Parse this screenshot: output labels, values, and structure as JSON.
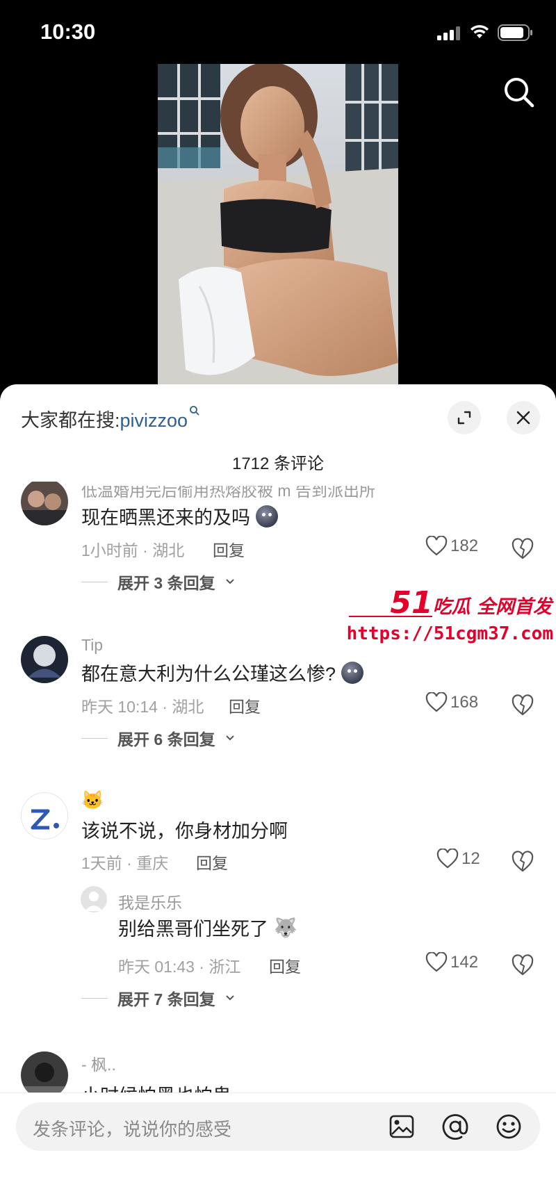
{
  "status_bar": {
    "time": "10:30"
  },
  "sheet": {
    "search_prefix": "大家都在搜:",
    "search_keyword": "pivizzoo",
    "comment_count": "1712 条评论"
  },
  "comments": [
    {
      "username": "低温婚用完后偷用热熔胶被 m 告到派出所",
      "text": "现在晒黑还来的及吗",
      "time_location": "1小时前 · 湖北",
      "reply": "回复",
      "likes": "182",
      "expand": "展开 3 条回复"
    },
    {
      "username": "Tip",
      "text": "都在意大利为什么公瑾这么惨?",
      "time_location": "昨天 10:14 · 湖北",
      "reply": "回复",
      "likes": "168",
      "expand": "展开 6 条回复"
    },
    {
      "username": "🐱",
      "text": "该说不说，你身材加分啊",
      "time_location": "1天前 · 重庆",
      "reply": "回复",
      "likes": "12",
      "sub_reply": {
        "username": "我是乐乐",
        "text": "别给黑哥们坐死了",
        "time_location": "昨天 01:43 · 浙江",
        "reply": "回复",
        "likes": "142"
      },
      "expand": "展开 7 条回复"
    },
    {
      "username": "- 枫..",
      "text": "小时候怕黑也怕鬼"
    }
  ],
  "watermark": {
    "brand_num": "51",
    "brand_text": "吃瓜 全网首发",
    "url": "https://51cgm37.com"
  },
  "input_bar": {
    "placeholder": "发条评论，说说你的感受",
    "icons": [
      "image-icon",
      "at-icon",
      "emoji-icon"
    ]
  },
  "colors": {
    "keyword": "#2f5f8f",
    "watermark": "#e4002b"
  }
}
